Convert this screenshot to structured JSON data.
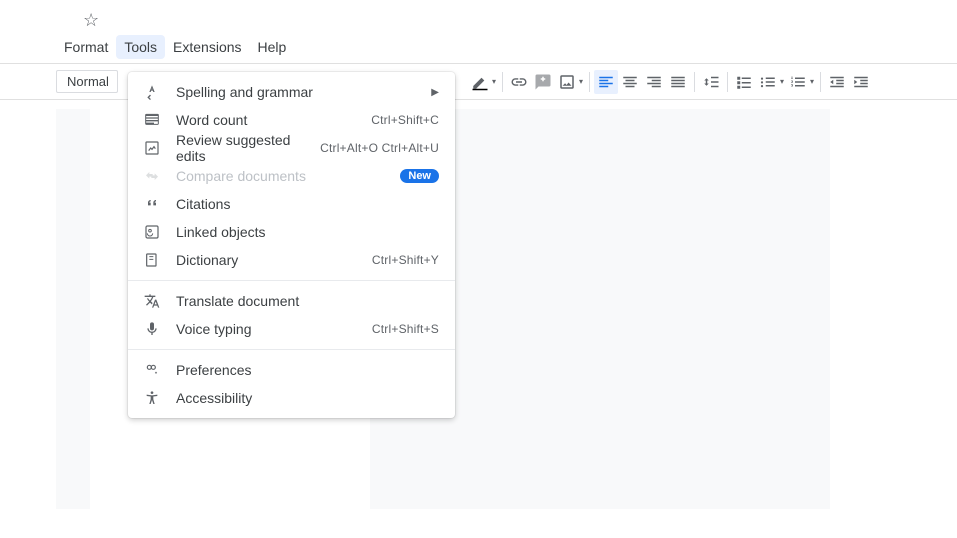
{
  "menubar": {
    "format": "Format",
    "tools": "Tools",
    "extensions": "Extensions",
    "help": "Help"
  },
  "toolbar": {
    "style_label": "Normal"
  },
  "tools_menu": {
    "spelling": {
      "label": "Spelling and grammar"
    },
    "wordcount": {
      "label": "Word count",
      "shortcut": "Ctrl+Shift+C"
    },
    "review": {
      "label": "Review suggested edits",
      "shortcut": "Ctrl+Alt+O Ctrl+Alt+U"
    },
    "compare": {
      "label": "Compare documents",
      "badge": "New"
    },
    "citations": {
      "label": "Citations"
    },
    "linked": {
      "label": "Linked objects"
    },
    "dictionary": {
      "label": "Dictionary",
      "shortcut": "Ctrl+Shift+Y"
    },
    "translate": {
      "label": "Translate document"
    },
    "voice": {
      "label": "Voice typing",
      "shortcut": "Ctrl+Shift+S"
    },
    "preferences": {
      "label": "Preferences"
    },
    "accessibility": {
      "label": "Accessibility"
    }
  }
}
